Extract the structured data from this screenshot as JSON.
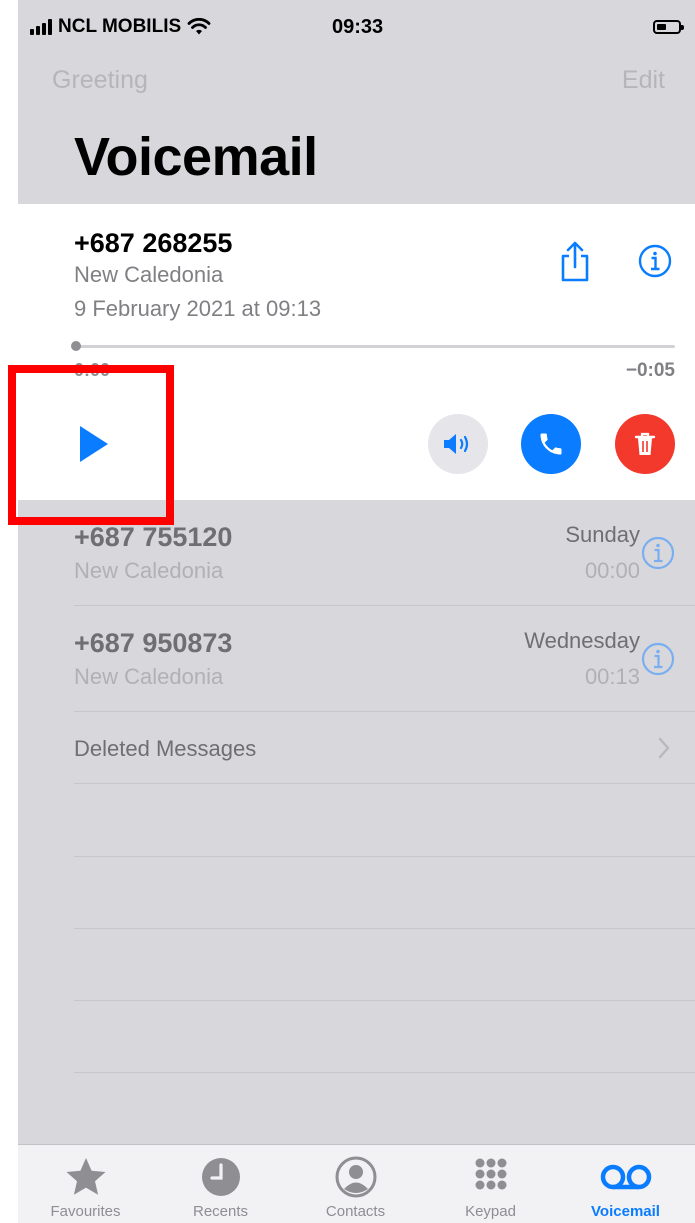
{
  "status": {
    "carrier": "NCL MOBILIS",
    "time": "09:33"
  },
  "nav": {
    "left": "Greeting",
    "right": "Edit"
  },
  "title": "Voicemail",
  "expanded": {
    "number": "+687 268255",
    "location": "New Caledonia",
    "datetime": "9 February 2021 at 09:13",
    "elapsed": "0:00",
    "remaining": "−0:05",
    "progress": 0
  },
  "list": [
    {
      "number": "+687 755120",
      "location": "New Caledonia",
      "day": "Sunday",
      "time": "00:00"
    },
    {
      "number": "+687 950873",
      "location": "New Caledonia",
      "day": "Wednesday",
      "time": "00:13"
    }
  ],
  "deleted_label": "Deleted Messages",
  "tabs": [
    {
      "label": "Favourites",
      "icon": "star-icon"
    },
    {
      "label": "Recents",
      "icon": "clock-icon"
    },
    {
      "label": "Contacts",
      "icon": "person-circle-icon"
    },
    {
      "label": "Keypad",
      "icon": "keypad-icon"
    },
    {
      "label": "Voicemail",
      "icon": "voicemail-icon",
      "active": true
    }
  ],
  "colors": {
    "accent": "#0a7cff",
    "delete": "#f2392c",
    "highlight": "#ff0000"
  }
}
